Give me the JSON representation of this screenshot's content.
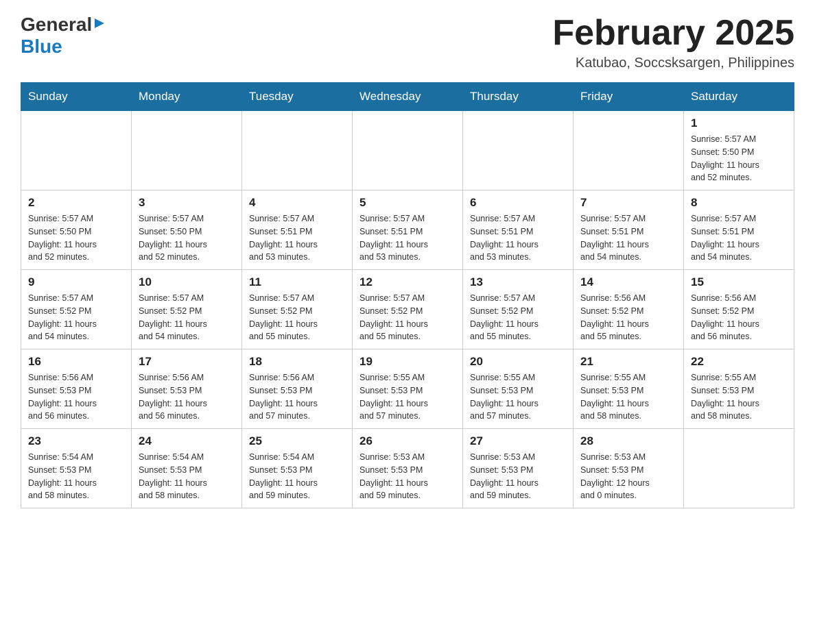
{
  "header": {
    "logo": {
      "general": "General",
      "blue": "Blue",
      "arrow_unicode": "▶"
    },
    "title": "February 2025",
    "subtitle": "Katubao, Soccsksargen, Philippines"
  },
  "calendar": {
    "weekdays": [
      "Sunday",
      "Monday",
      "Tuesday",
      "Wednesday",
      "Thursday",
      "Friday",
      "Saturday"
    ],
    "weeks": [
      [
        {
          "day": "",
          "info": ""
        },
        {
          "day": "",
          "info": ""
        },
        {
          "day": "",
          "info": ""
        },
        {
          "day": "",
          "info": ""
        },
        {
          "day": "",
          "info": ""
        },
        {
          "day": "",
          "info": ""
        },
        {
          "day": "1",
          "info": "Sunrise: 5:57 AM\nSunset: 5:50 PM\nDaylight: 11 hours\nand 52 minutes."
        }
      ],
      [
        {
          "day": "2",
          "info": "Sunrise: 5:57 AM\nSunset: 5:50 PM\nDaylight: 11 hours\nand 52 minutes."
        },
        {
          "day": "3",
          "info": "Sunrise: 5:57 AM\nSunset: 5:50 PM\nDaylight: 11 hours\nand 52 minutes."
        },
        {
          "day": "4",
          "info": "Sunrise: 5:57 AM\nSunset: 5:51 PM\nDaylight: 11 hours\nand 53 minutes."
        },
        {
          "day": "5",
          "info": "Sunrise: 5:57 AM\nSunset: 5:51 PM\nDaylight: 11 hours\nand 53 minutes."
        },
        {
          "day": "6",
          "info": "Sunrise: 5:57 AM\nSunset: 5:51 PM\nDaylight: 11 hours\nand 53 minutes."
        },
        {
          "day": "7",
          "info": "Sunrise: 5:57 AM\nSunset: 5:51 PM\nDaylight: 11 hours\nand 54 minutes."
        },
        {
          "day": "8",
          "info": "Sunrise: 5:57 AM\nSunset: 5:51 PM\nDaylight: 11 hours\nand 54 minutes."
        }
      ],
      [
        {
          "day": "9",
          "info": "Sunrise: 5:57 AM\nSunset: 5:52 PM\nDaylight: 11 hours\nand 54 minutes."
        },
        {
          "day": "10",
          "info": "Sunrise: 5:57 AM\nSunset: 5:52 PM\nDaylight: 11 hours\nand 54 minutes."
        },
        {
          "day": "11",
          "info": "Sunrise: 5:57 AM\nSunset: 5:52 PM\nDaylight: 11 hours\nand 55 minutes."
        },
        {
          "day": "12",
          "info": "Sunrise: 5:57 AM\nSunset: 5:52 PM\nDaylight: 11 hours\nand 55 minutes."
        },
        {
          "day": "13",
          "info": "Sunrise: 5:57 AM\nSunset: 5:52 PM\nDaylight: 11 hours\nand 55 minutes."
        },
        {
          "day": "14",
          "info": "Sunrise: 5:56 AM\nSunset: 5:52 PM\nDaylight: 11 hours\nand 55 minutes."
        },
        {
          "day": "15",
          "info": "Sunrise: 5:56 AM\nSunset: 5:52 PM\nDaylight: 11 hours\nand 56 minutes."
        }
      ],
      [
        {
          "day": "16",
          "info": "Sunrise: 5:56 AM\nSunset: 5:53 PM\nDaylight: 11 hours\nand 56 minutes."
        },
        {
          "day": "17",
          "info": "Sunrise: 5:56 AM\nSunset: 5:53 PM\nDaylight: 11 hours\nand 56 minutes."
        },
        {
          "day": "18",
          "info": "Sunrise: 5:56 AM\nSunset: 5:53 PM\nDaylight: 11 hours\nand 57 minutes."
        },
        {
          "day": "19",
          "info": "Sunrise: 5:55 AM\nSunset: 5:53 PM\nDaylight: 11 hours\nand 57 minutes."
        },
        {
          "day": "20",
          "info": "Sunrise: 5:55 AM\nSunset: 5:53 PM\nDaylight: 11 hours\nand 57 minutes."
        },
        {
          "day": "21",
          "info": "Sunrise: 5:55 AM\nSunset: 5:53 PM\nDaylight: 11 hours\nand 58 minutes."
        },
        {
          "day": "22",
          "info": "Sunrise: 5:55 AM\nSunset: 5:53 PM\nDaylight: 11 hours\nand 58 minutes."
        }
      ],
      [
        {
          "day": "23",
          "info": "Sunrise: 5:54 AM\nSunset: 5:53 PM\nDaylight: 11 hours\nand 58 minutes."
        },
        {
          "day": "24",
          "info": "Sunrise: 5:54 AM\nSunset: 5:53 PM\nDaylight: 11 hours\nand 58 minutes."
        },
        {
          "day": "25",
          "info": "Sunrise: 5:54 AM\nSunset: 5:53 PM\nDaylight: 11 hours\nand 59 minutes."
        },
        {
          "day": "26",
          "info": "Sunrise: 5:53 AM\nSunset: 5:53 PM\nDaylight: 11 hours\nand 59 minutes."
        },
        {
          "day": "27",
          "info": "Sunrise: 5:53 AM\nSunset: 5:53 PM\nDaylight: 11 hours\nand 59 minutes."
        },
        {
          "day": "28",
          "info": "Sunrise: 5:53 AM\nSunset: 5:53 PM\nDaylight: 12 hours\nand 0 minutes."
        },
        {
          "day": "",
          "info": ""
        }
      ]
    ]
  }
}
